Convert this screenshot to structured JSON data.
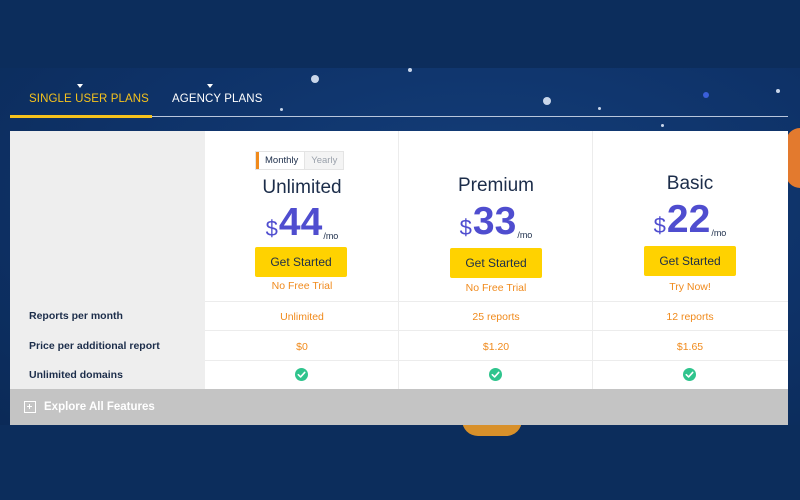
{
  "tabs": {
    "single_user": "SINGLE USER PLANS",
    "agency": "AGENCY PLANS"
  },
  "billing_toggle": {
    "monthly": "Monthly",
    "yearly": "Yearly",
    "selected": "Monthly"
  },
  "plans": [
    {
      "name": "Unlimited",
      "currency": "$",
      "price": "44",
      "period": "/mo",
      "cta": "Get Started",
      "note": "No Free Trial",
      "reports_per_month": "Unlimited",
      "price_per_additional_report": "$0",
      "unlimited_domains": true
    },
    {
      "name": "Premium",
      "currency": "$",
      "price": "33",
      "period": "/mo",
      "cta": "Get Started",
      "note": "No Free Trial",
      "reports_per_month": "25 reports",
      "price_per_additional_report": "$1.20",
      "unlimited_domains": true
    },
    {
      "name": "Basic",
      "currency": "$",
      "price": "22",
      "period": "/mo",
      "cta": "Get Started",
      "note": "Try Now!",
      "reports_per_month": "12 reports",
      "price_per_additional_report": "$1.65",
      "unlimited_domains": true
    }
  ],
  "features": {
    "reports_per_month": "Reports per month",
    "price_per_additional_report": "Price per additional report",
    "unlimited_domains": "Unlimited domains"
  },
  "explore": {
    "label": "Explore All Features",
    "icon": "plus-square-icon"
  },
  "colors": {
    "background": "#0c2d5c",
    "accent_yellow": "#ffd200",
    "active_tab": "#f6c21c",
    "price": "#4f4dcf",
    "orange_text": "#f08a1c",
    "check_green": "#2fc48d",
    "explore_bar": "#c4c4c4"
  }
}
